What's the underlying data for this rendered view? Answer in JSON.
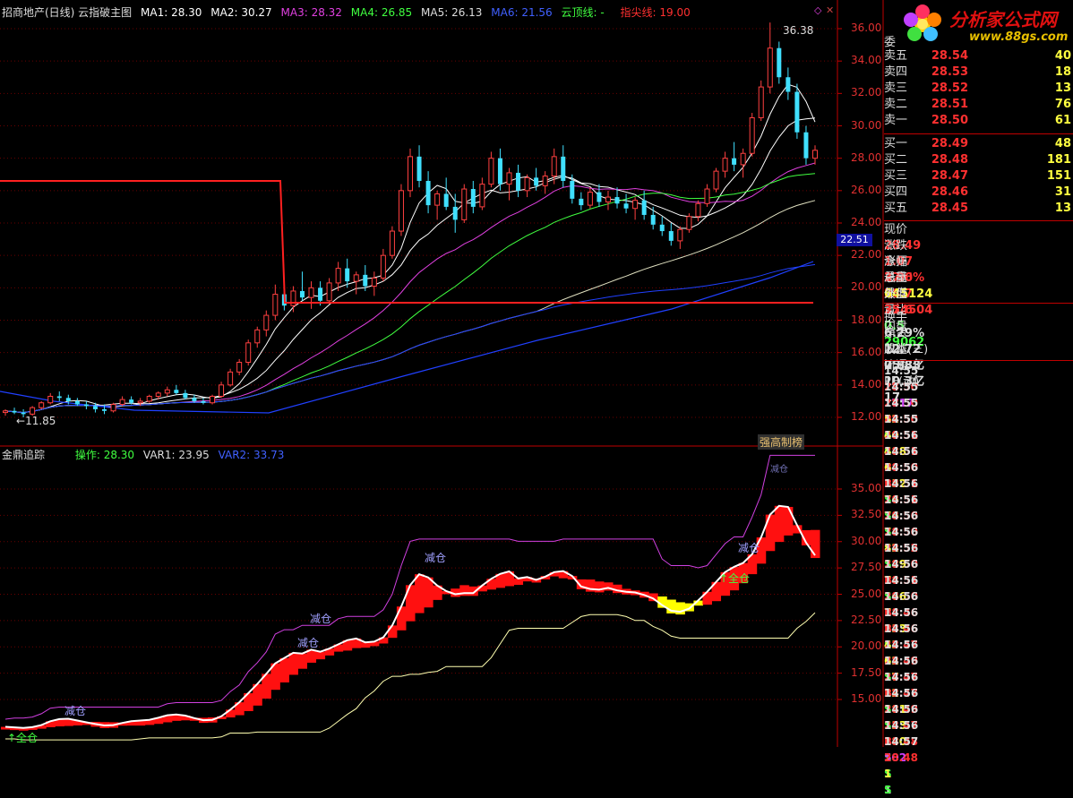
{
  "colors": {
    "bg": "#000000",
    "grid": "#7a0000",
    "axis": "#c00000",
    "up": "#ff4040",
    "down": "#40e0ff",
    "red": "#ff3030",
    "cyan": "#00e0e0",
    "yellow": "#ffff00",
    "green": "#40ff40",
    "magenta": "#e040e0",
    "blue": "#4040ff",
    "white": "#ffffff"
  },
  "main_header": {
    "title": "招商地产(日线) 云指破主图",
    "ma1": "MA1: 28.30",
    "ma2": "MA2: 30.27",
    "ma3": "MA3: 28.32",
    "ma4": "MA4: 26.85",
    "ma5": "MA5: 26.13",
    "ma6": "MA6: 21.56",
    "yunding": "云顶线: -",
    "zhijian": "指尖线: 19.00"
  },
  "main_axis": {
    "ticks": [
      "36.00",
      "34.00",
      "32.00",
      "30.00",
      "28.00",
      "26.00",
      "24.00",
      "22.00",
      "20.00",
      "18.00",
      "16.00",
      "14.00",
      "12.00"
    ],
    "current_tag": "22.51"
  },
  "main_annotations": {
    "high": "36.38",
    "low": "11.85",
    "badge": "强高制榜"
  },
  "sub_header": {
    "title": "金鼎追踪",
    "op": "操作: 28.30",
    "var1": "VAR1: 23.95",
    "var2": "VAR2: 33.73"
  },
  "sub_axis": {
    "ticks": [
      "35.00",
      "32.50",
      "30.00",
      "27.50",
      "25.00",
      "22.50",
      "20.00",
      "17.50",
      "15.00"
    ]
  },
  "sub_annotations": {
    "jiancang1": "减仓",
    "jiancang2": "减仓",
    "jiancang3": "减仓",
    "jiancang4": "减仓",
    "jiancang5": "减仓",
    "quancang1": "↑全仓",
    "quancang2": "↑全仓",
    "top_cut": "减仓"
  },
  "logo": {
    "title": "分析家公式网",
    "url": "www.88gs.com"
  },
  "orderbook": {
    "title": "委",
    "asks": [
      {
        "label": "卖五",
        "price": "28.54",
        "vol": "40"
      },
      {
        "label": "卖四",
        "price": "28.53",
        "vol": "18"
      },
      {
        "label": "卖三",
        "price": "28.52",
        "vol": "13"
      },
      {
        "label": "卖二",
        "price": "28.51",
        "vol": "76"
      },
      {
        "label": "卖一",
        "price": "28.50",
        "vol": "61"
      }
    ],
    "bids": [
      {
        "label": "买一",
        "price": "28.49",
        "vol": "48"
      },
      {
        "label": "买二",
        "price": "28.48",
        "vol": "181"
      },
      {
        "label": "买三",
        "price": "28.47",
        "vol": "151"
      },
      {
        "label": "买四",
        "price": "28.46",
        "vol": "31"
      },
      {
        "label": "买五",
        "price": "28.45",
        "vol": "13"
      }
    ]
  },
  "stats": [
    {
      "l1": "现价",
      "v1": "28.49",
      "l2": "今开",
      "v2": "27.6"
    },
    {
      "l1": "涨跌",
      "v1": "1.07",
      "l2": "最高",
      "v2": "28.7"
    },
    {
      "l1": "涨幅",
      "v1": "3.90%",
      "l2": "最低",
      "v2": "27.6"
    },
    {
      "l1": "总量",
      "v1": "645124",
      "l2": "量比",
      "v2": "0.5"
    },
    {
      "l1": "外盘",
      "v1": "354504",
      "l2": "内盘",
      "v2": "29062"
    },
    {
      "l1": "换手",
      "v1": "6.29%",
      "l2": "股本",
      "v2": "25.8亿"
    },
    {
      "l1": "净资",
      "v1": "12.72",
      "l2": "流通",
      "v2": "10.3亿"
    },
    {
      "l1": "收益(三)",
      "v1": "0.833",
      "l2": "PE(动)",
      "v2": "17."
    }
  ],
  "ticks": [
    {
      "t": "14:55",
      "p": "28.50",
      "v": "1717",
      "s": "B",
      "x": "6"
    },
    {
      "t": "14:55",
      "p": "28.50",
      "v": "52",
      "s": "S",
      "x": "1"
    },
    {
      "t": "14:55",
      "p": "28.50",
      "v": "40",
      "s": "S",
      "x": "1"
    },
    {
      "t": "14:55",
      "p": "28.51",
      "v": "488",
      "s": "B",
      "x": "1"
    },
    {
      "t": "14:56",
      "p": "28.51",
      "v": "6",
      "s": "B",
      "x": "1"
    },
    {
      "t": "14:56",
      "p": "28.50",
      "v": "152",
      "s": "S",
      "x": "2"
    },
    {
      "t": "14:56",
      "p": "28.51",
      "v": "76",
      "s": "S",
      "x": "1"
    },
    {
      "t": "14:56",
      "p": "28.51",
      "v": "76",
      "s": "S",
      "x": "1"
    },
    {
      "t": "14:56",
      "p": "28.50",
      "v": "74",
      "s": "S",
      "x": "1"
    },
    {
      "t": "14:56",
      "p": "28.50",
      "v": "82",
      "s": "S",
      "x": "1"
    },
    {
      "t": "14:56",
      "p": "28.52",
      "v": "189",
      "s": "B",
      "x": "2"
    },
    {
      "t": "14:56",
      "p": "28.50",
      "v": "74",
      "s": "S",
      "x": "1"
    },
    {
      "t": "14:56",
      "p": "28.51",
      "v": "166",
      "s": "B",
      "x": "2"
    },
    {
      "t": "14:56",
      "p": "28.50",
      "v": "7",
      "s": "B",
      "x": "1"
    },
    {
      "t": "14:56",
      "p": "28.46",
      "v": "233",
      "s": "S",
      "x": "1"
    },
    {
      "t": "14:56",
      "p": "28.46",
      "v": "43",
      "s": "S",
      "x": "1"
    },
    {
      "t": "14:56",
      "p": "28.47",
      "v": "62",
      "s": "S",
      "x": "1"
    },
    {
      "t": "14:56",
      "p": "28.49",
      "v": "17",
      "s": "B",
      "x": "1"
    },
    {
      "t": "14:56",
      "p": "28.47",
      "v": "22",
      "s": "S",
      "x": "1"
    },
    {
      "t": "14:56",
      "p": "28.47",
      "v": "281",
      "s": "S",
      "x": "1"
    },
    {
      "t": "14:56",
      "p": "28.49",
      "v": "133",
      "s": "B",
      "x": "1"
    },
    {
      "t": "14:56",
      "p": "28.47",
      "v": "180",
      "s": "S",
      "x": "1"
    },
    {
      "t": "14:56",
      "p": "28.48",
      "v": "502",
      "s": "S",
      "x": "1"
    },
    {
      "t": "14:57",
      "p": "28.48",
      "v": "1",
      "s": "S",
      "x": ""
    }
  ],
  "candles": [
    [
      12.3,
      12.5,
      12.1,
      12.4
    ],
    [
      12.4,
      12.6,
      12.2,
      12.3
    ],
    [
      12.3,
      12.5,
      12.0,
      12.2
    ],
    [
      12.2,
      12.7,
      12.1,
      12.6
    ],
    [
      12.6,
      13.0,
      12.5,
      12.9
    ],
    [
      12.9,
      13.5,
      12.8,
      13.3
    ],
    [
      13.3,
      13.6,
      13.0,
      13.2
    ],
    [
      13.2,
      13.4,
      12.8,
      13.0
    ],
    [
      13.0,
      13.2,
      12.7,
      12.8
    ],
    [
      12.8,
      13.0,
      12.5,
      12.7
    ],
    [
      12.7,
      12.9,
      12.3,
      12.5
    ],
    [
      12.5,
      12.8,
      12.2,
      12.4
    ],
    [
      12.4,
      12.9,
      12.3,
      12.8
    ],
    [
      12.8,
      13.3,
      12.7,
      13.1
    ],
    [
      13.1,
      13.3,
      12.8,
      12.9
    ],
    [
      12.9,
      13.2,
      12.7,
      13.0
    ],
    [
      13.0,
      13.4,
      12.9,
      13.3
    ],
    [
      13.3,
      13.6,
      13.1,
      13.5
    ],
    [
      13.5,
      13.9,
      13.3,
      13.7
    ],
    [
      13.7,
      14.0,
      13.4,
      13.5
    ],
    [
      13.5,
      13.7,
      13.1,
      13.2
    ],
    [
      13.2,
      13.4,
      12.9,
      13.0
    ],
    [
      13.0,
      13.2,
      12.8,
      12.9
    ],
    [
      12.9,
      13.4,
      12.8,
      13.3
    ],
    [
      13.3,
      14.2,
      13.2,
      14.0
    ],
    [
      14.0,
      15.0,
      13.9,
      14.8
    ],
    [
      14.8,
      15.6,
      14.6,
      15.4
    ],
    [
      15.4,
      16.8,
      15.2,
      16.6
    ],
    [
      16.6,
      17.6,
      16.3,
      17.4
    ],
    [
      17.4,
      18.6,
      17.0,
      18.3
    ],
    [
      18.3,
      20.2,
      18.0,
      19.6
    ],
    [
      19.6,
      20.6,
      18.6,
      18.9
    ],
    [
      18.9,
      20.1,
      18.5,
      19.8
    ],
    [
      19.8,
      21.0,
      19.2,
      19.4
    ],
    [
      19.4,
      20.4,
      18.7,
      20.0
    ],
    [
      20.0,
      20.4,
      18.9,
      19.2
    ],
    [
      19.2,
      20.6,
      19.0,
      20.3
    ],
    [
      20.3,
      21.6,
      19.8,
      21.2
    ],
    [
      21.2,
      21.8,
      20.0,
      20.4
    ],
    [
      20.4,
      21.0,
      19.6,
      20.8
    ],
    [
      20.8,
      21.4,
      19.8,
      20.1
    ],
    [
      20.1,
      21.0,
      19.5,
      20.6
    ],
    [
      20.6,
      22.4,
      20.4,
      22.0
    ],
    [
      22.0,
      23.8,
      21.8,
      23.5
    ],
    [
      23.5,
      26.4,
      23.2,
      26.0
    ],
    [
      26.0,
      28.6,
      25.6,
      28.1
    ],
    [
      28.1,
      28.8,
      26.2,
      26.6
    ],
    [
      26.6,
      27.2,
      24.6,
      25.1
    ],
    [
      25.1,
      26.0,
      24.2,
      25.8
    ],
    [
      25.8,
      26.8,
      24.8,
      25.0
    ],
    [
      25.0,
      25.8,
      23.4,
      24.2
    ],
    [
      24.2,
      26.4,
      24.0,
      26.1
    ],
    [
      26.1,
      26.6,
      24.6,
      25.0
    ],
    [
      25.0,
      26.8,
      24.8,
      26.4
    ],
    [
      26.4,
      28.4,
      26.2,
      28.0
    ],
    [
      28.0,
      28.6,
      26.0,
      26.4
    ],
    [
      26.4,
      27.4,
      25.4,
      27.1
    ],
    [
      27.1,
      27.6,
      25.6,
      26.0
    ],
    [
      26.0,
      27.0,
      25.6,
      26.8
    ],
    [
      26.8,
      27.4,
      26.0,
      26.3
    ],
    [
      26.3,
      27.2,
      25.8,
      26.9
    ],
    [
      26.9,
      28.6,
      26.4,
      28.1
    ],
    [
      28.1,
      28.8,
      26.2,
      26.6
    ],
    [
      26.6,
      27.0,
      25.2,
      25.5
    ],
    [
      25.5,
      25.9,
      24.8,
      25.1
    ],
    [
      25.1,
      26.2,
      24.9,
      25.9
    ],
    [
      25.9,
      26.4,
      25.0,
      25.3
    ],
    [
      25.3,
      26.0,
      24.8,
      25.6
    ],
    [
      25.6,
      26.2,
      24.9,
      25.2
    ],
    [
      25.2,
      25.8,
      24.6,
      24.9
    ],
    [
      24.9,
      25.6,
      24.2,
      25.4
    ],
    [
      25.4,
      26.0,
      24.2,
      24.5
    ],
    [
      24.5,
      25.0,
      23.6,
      23.9
    ],
    [
      23.9,
      24.4,
      23.2,
      23.5
    ],
    [
      23.5,
      24.0,
      22.6,
      22.9
    ],
    [
      22.9,
      23.8,
      22.4,
      23.6
    ],
    [
      23.6,
      24.6,
      23.4,
      24.4
    ],
    [
      24.4,
      25.4,
      24.1,
      25.2
    ],
    [
      25.2,
      26.4,
      25.0,
      26.1
    ],
    [
      26.1,
      27.4,
      25.9,
      27.2
    ],
    [
      27.2,
      28.4,
      26.8,
      28.0
    ],
    [
      28.0,
      29.0,
      27.2,
      27.6
    ],
    [
      27.6,
      28.6,
      26.8,
      28.3
    ],
    [
      28.3,
      30.8,
      28.1,
      30.5
    ],
    [
      30.5,
      32.8,
      30.3,
      32.4
    ],
    [
      32.4,
      36.38,
      32.0,
      34.8
    ],
    [
      34.8,
      35.2,
      32.6,
      33.0
    ],
    [
      33.0,
      33.6,
      31.6,
      32.1
    ],
    [
      32.1,
      32.6,
      29.2,
      29.6
    ],
    [
      29.6,
      30.0,
      27.6,
      28.0
    ],
    [
      28.0,
      28.8,
      27.6,
      28.49
    ]
  ]
}
